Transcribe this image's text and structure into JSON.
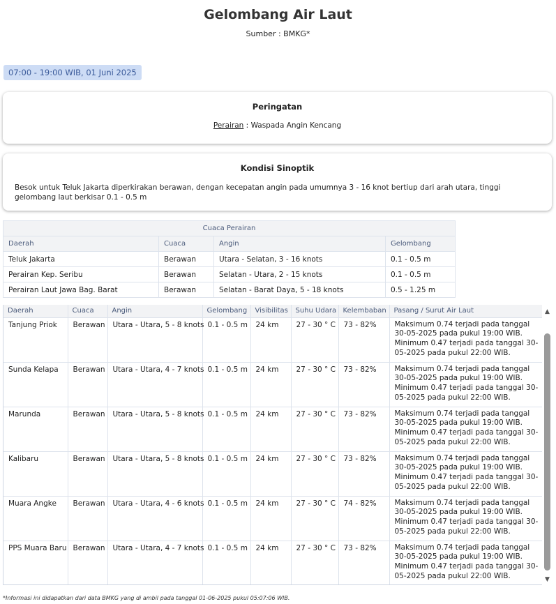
{
  "header": {
    "title": "Gelombang Air Laut",
    "source": "Sumber : BMKG*"
  },
  "period": "07:00 - 19:00 WIB, 01 Juni 2025",
  "warning": {
    "title": "Peringatan",
    "label": "Perairan",
    "separator": " : ",
    "text": "Waspada Angin Kencang"
  },
  "synoptic": {
    "title": "Kondisi Sinoptik",
    "text": "Besok untuk Teluk Jakarta diperkirakan berawan, dengan kecepatan angin pada umumnya 3 - 16 knot bertiup dari arah utara, tinggi gelombang laut berkisar 0.1 - 0.5 m"
  },
  "weather_table": {
    "caption": "Cuaca Perairan",
    "headers": [
      "Daerah",
      "Cuaca",
      "Angin",
      "Gelombang"
    ],
    "rows": [
      [
        "Teluk Jakarta",
        "Berawan",
        "Utara - Selatan, 3 - 16 knots",
        "0.1 - 0.5 m"
      ],
      [
        "Perairan Kep. Seribu",
        "Berawan",
        "Selatan - Utara, 2 - 15 knots",
        "0.1 - 0.5 m"
      ],
      [
        "Perairan Laut Jawa Bag. Barat",
        "Berawan",
        "Selatan - Barat Daya, 5 - 18 knots",
        "0.5 - 1.25 m"
      ]
    ]
  },
  "port_table": {
    "headers": [
      "Daerah",
      "Cuaca",
      "Angin",
      "Gelombang",
      "Visibilitas",
      "Suhu Udara",
      "Kelembaban",
      "Pasang / Surut Air Laut"
    ],
    "rows": [
      [
        "Tanjung Priok",
        "Berawan",
        "Utara - Utara, 5 - 8 knots",
        "0.1 - 0.5 m",
        "24 km",
        "27 - 30 ° C",
        "73 - 82%",
        "Maksimum 0.74 terjadi pada tanggal 30-05-2025 pada pukul 19:00 WIB. Minimum 0.47 terjadi pada tanggal 30-05-2025 pada pukul 22:00 WIB."
      ],
      [
        "Sunda Kelapa",
        "Berawan",
        "Utara - Utara, 4 - 7 knots",
        "0.1 - 0.5 m",
        "24 km",
        "27 - 30 ° C",
        "73 - 82%",
        "Maksimum 0.74 terjadi pada tanggal 30-05-2025 pada pukul 19:00 WIB. Minimum 0.47 terjadi pada tanggal 30-05-2025 pada pukul 22:00 WIB."
      ],
      [
        "Marunda",
        "Berawan",
        "Utara - Utara, 5 - 8 knots",
        "0.1 - 0.5 m",
        "24 km",
        "27 - 30 ° C",
        "73 - 82%",
        "Maksimum 0.74 terjadi pada tanggal 30-05-2025 pada pukul 19:00 WIB. Minimum 0.47 terjadi pada tanggal 30-05-2025 pada pukul 22:00 WIB."
      ],
      [
        "Kalibaru",
        "Berawan",
        "Utara - Utara, 5 - 8 knots",
        "0.1 - 0.5 m",
        "24 km",
        "27 - 30 ° C",
        "73 - 82%",
        "Maksimum 0.74 terjadi pada tanggal 30-05-2025 pada pukul 19:00 WIB. Minimum 0.47 terjadi pada tanggal 30-05-2025 pada pukul 22:00 WIB."
      ],
      [
        "Muara Angke",
        "Berawan",
        "Utara - Utara, 4 - 6 knots",
        "0.1 - 0.5 m",
        "24 km",
        "27 - 30 ° C",
        "74 - 82%",
        "Maksimum 0.74 terjadi pada tanggal 30-05-2025 pada pukul 19:00 WIB. Minimum 0.47 terjadi pada tanggal 30-05-2025 pada pukul 22:00 WIB."
      ],
      [
        "PPS Muara Baru",
        "Berawan",
        "Utara - Utara, 4 - 7 knots",
        "0.1 - 0.5 m",
        "24 km",
        "27 - 30 ° C",
        "73 - 82%",
        "Maksimum 0.74 terjadi pada tanggal 30-05-2025 pada pukul 19:00 WIB. Minimum 0.47 terjadi pada tanggal 30-05-2025 pada pukul 22:00 WIB."
      ]
    ]
  },
  "scrollbar": {
    "up_icon": "▲",
    "down_icon": "▼"
  },
  "footnote": "*Informasi ini didapatkan dari data BMKG yang di ambil pada tanggal 01-06-2025 pukul 05:07:06 WIB."
}
